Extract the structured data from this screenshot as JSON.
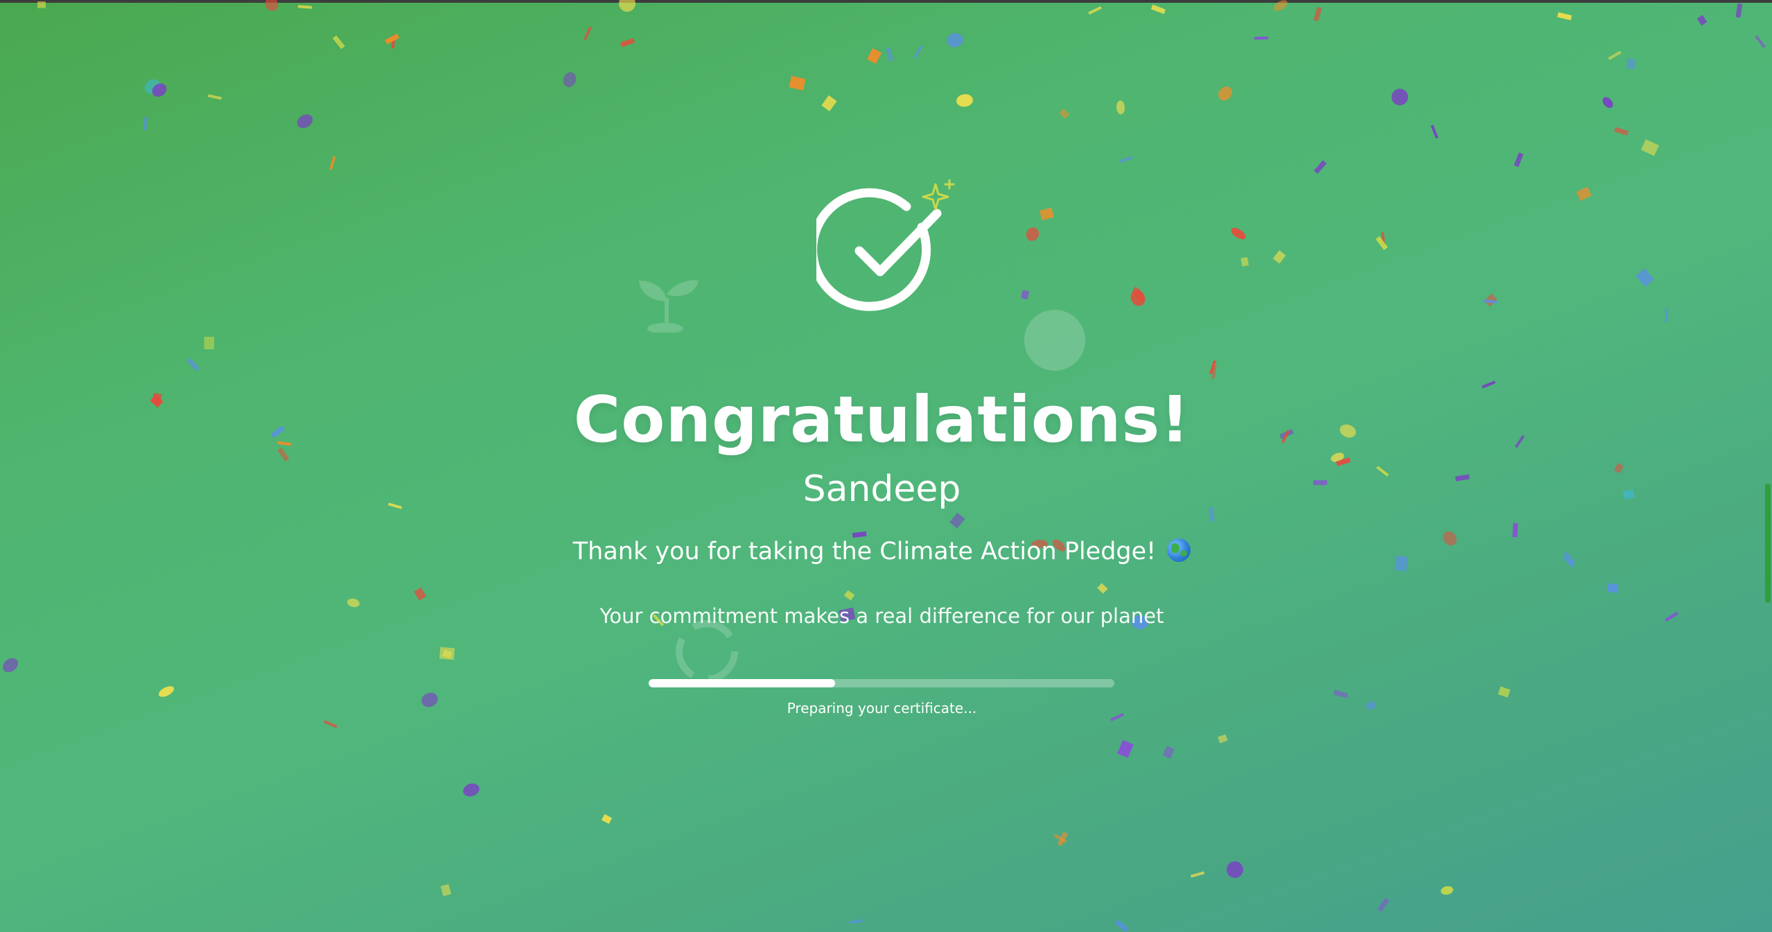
{
  "celebration": {
    "title": "Congratulations!",
    "name": "Sandeep",
    "thanks": "Thank you for taking the Climate Action Pledge!",
    "thanks_emoji": "globe-emoji",
    "commitment": "Your commitment makes a real difference for our planet",
    "progress_label": "Preparing your certificate...",
    "progress_fraction": 0.4
  },
  "icons": {
    "main": "check-circle-icon",
    "sparkle": "sparkle-icon",
    "background": [
      "sprout-icon",
      "earth-icon",
      "recycle-icon"
    ]
  },
  "colors": {
    "background_start": "#4aa84f",
    "background_end": "#46a08e",
    "text": "#ffffff",
    "sparkle": "#c9d84a",
    "scrollbar": "#2f9e3c",
    "confetti": [
      "#f4e04d",
      "#e84a3c",
      "#f48c2a",
      "#5b8def",
      "#7b3fc4",
      "#3fb9d9",
      "#c9d84a",
      "#8a4dd8"
    ]
  }
}
